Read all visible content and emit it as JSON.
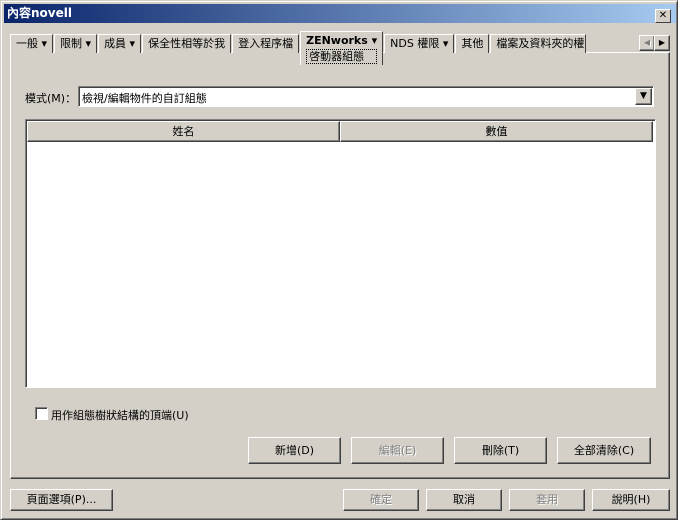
{
  "window": {
    "title": "內容novell",
    "close": "✕"
  },
  "tabs": [
    {
      "label": "一般",
      "dropdown": true
    },
    {
      "label": "限制",
      "dropdown": true
    },
    {
      "label": "成員",
      "dropdown": true
    },
    {
      "label": "保全性相等於我",
      "dropdown": false
    },
    {
      "label": "登入程序檔",
      "dropdown": false
    },
    {
      "label": "ZENworks",
      "dropdown": true,
      "sub": "啓動器組態",
      "active": true
    },
    {
      "label": "NDS 權限",
      "dropdown": true
    },
    {
      "label": "其他",
      "dropdown": false
    },
    {
      "label": "檔案及資料夾的權",
      "dropdown": false
    }
  ],
  "mode": {
    "label": "模式(M)：",
    "value": "檢視/編輯物件的自訂組態"
  },
  "table": {
    "columns": [
      "姓名",
      "數值"
    ],
    "rows": []
  },
  "checkbox": {
    "label": "用作組態樹狀結構的頂端(U)",
    "checked": false
  },
  "actions": {
    "add": "新增(D)",
    "edit": "編輯(E)",
    "delete": "刪除(T)",
    "clear_all": "全部清除(C)"
  },
  "footer": {
    "page_options": "頁面選項(P)...",
    "ok": "確定",
    "cancel": "取消",
    "apply": "套用",
    "help": "說明(H)"
  }
}
